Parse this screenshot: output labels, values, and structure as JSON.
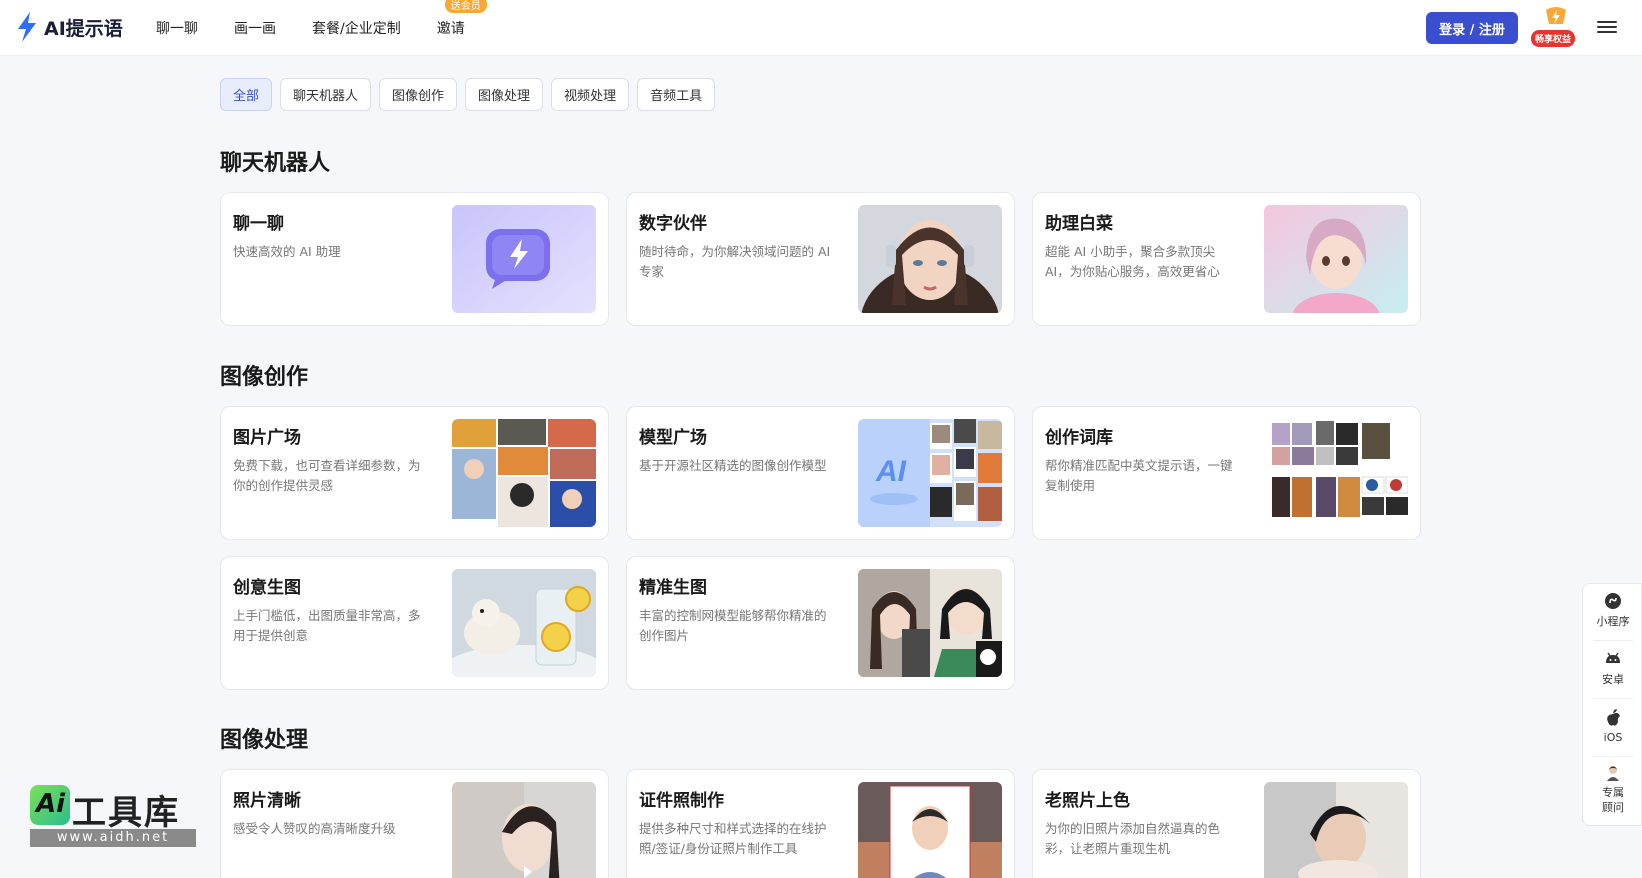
{
  "header": {
    "logo_text": "AI提示语",
    "nav": [
      {
        "label": "聊一聊"
      },
      {
        "label": "画一画"
      },
      {
        "label": "套餐/企业定制"
      },
      {
        "label": "邀请",
        "badge": "送会员"
      }
    ],
    "login_label": "登录 / 注册",
    "vip_tag": "畅享权益"
  },
  "filters": [
    {
      "label": "全部",
      "active": true
    },
    {
      "label": "聊天机器人"
    },
    {
      "label": "图像创作"
    },
    {
      "label": "图像处理"
    },
    {
      "label": "视频处理"
    },
    {
      "label": "音频工具"
    }
  ],
  "sections": [
    {
      "title": "聊天机器人",
      "cards": [
        {
          "title": "聊一聊",
          "desc": "快速高效的 AI 助理"
        },
        {
          "title": "数字伙伴",
          "desc": "随时待命，为你解决领域问题的 AI 专家"
        },
        {
          "title": "助理白菜",
          "desc": "超能 AI 小助手，聚合多款顶尖 AI，为你贴心服务，高效更省心"
        }
      ]
    },
    {
      "title": "图像创作",
      "cards": [
        {
          "title": "图片广场",
          "desc": "免费下载，也可查看详细参数，为你的创作提供灵感"
        },
        {
          "title": "模型广场",
          "desc": "基于开源社区精选的图像创作模型"
        },
        {
          "title": "创作词库",
          "desc": "帮你精准匹配中英文提示语，一键复制使用"
        },
        {
          "title": "创意生图",
          "desc": "上手门槛低，出图质量非常高，多用于提供创意"
        },
        {
          "title": "精准生图",
          "desc": "丰富的控制网模型能够帮你精准的创作图片"
        }
      ]
    },
    {
      "title": "图像处理",
      "cards": [
        {
          "title": "照片清晰",
          "desc": "感受令人赞叹的高清晰度升级"
        },
        {
          "title": "证件照制作",
          "desc": "提供多种尺寸和样式选择的在线护照/签证/身份证照片制作工具"
        },
        {
          "title": "老照片上色",
          "desc": "为你的旧照片添加自然逼真的色彩，让老照片重现生机"
        }
      ]
    }
  ],
  "side_rail": [
    {
      "label": "小程序",
      "icon": "mini-program-icon"
    },
    {
      "label": "安卓",
      "icon": "android-icon"
    },
    {
      "label": "iOS",
      "icon": "apple-icon"
    },
    {
      "label": "专属顾问",
      "icon": "advisor-icon"
    }
  ],
  "watermark": {
    "brand": "工具库",
    "logo": "Ai",
    "url": "www.aidh.net"
  }
}
